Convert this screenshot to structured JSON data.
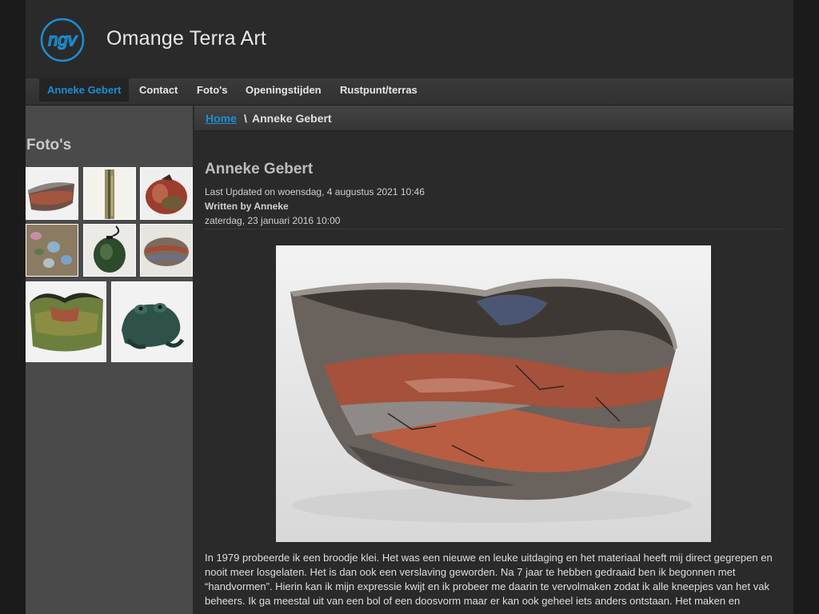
{
  "site": {
    "title": "Omange Terra Art",
    "logo_text": "ngv",
    "accent_color": "#1b8fd6"
  },
  "nav": {
    "items": [
      {
        "label": "Anneke Gebert",
        "active": true
      },
      {
        "label": "Contact",
        "active": false
      },
      {
        "label": "Foto's",
        "active": false
      },
      {
        "label": "Openingstijden",
        "active": false
      },
      {
        "label": "Rustpunt/terras",
        "active": false
      }
    ]
  },
  "sidebar": {
    "title": "Foto's",
    "thumbnails": [
      {
        "name": "thumb-raku-bowl"
      },
      {
        "name": "thumb-tall-vase"
      },
      {
        "name": "thumb-round-pot"
      },
      {
        "name": "thumb-garden-stones"
      },
      {
        "name": "thumb-green-lantern"
      },
      {
        "name": "thumb-oval-stone"
      },
      {
        "name": "thumb-green-bowl"
      },
      {
        "name": "thumb-frog"
      }
    ]
  },
  "breadcrumb": {
    "home": "Home",
    "separator": "\\",
    "current": "Anneke Gebert"
  },
  "article": {
    "title": "Anneke Gebert",
    "last_updated": "Last Updated on woensdag, 4 augustus 2021 10:46",
    "written_by": "Written by Anneke",
    "created": "zaterdag, 23 januari 2016 10:00",
    "body": "In 1979 probeerde ik een broodje klei. Het was een nieuwe en leuke uitdaging en het materiaal heeft mij direct gegrepen en nooit meer losgelaten. Het is dan ook een verslaving geworden. Na 7 jaar te hebben gedraaid ben ik begonnen met “handvormen”. Hierin kan ik mijn expressie kwijt en ik probeer me daarin te vervolmaken zodat ik alle kneepjes van het vak beheers. Ik ga meestal uit van een bol of een doosvorm maar er kan ook geheel iets anders ontstaan. Het maken en"
  }
}
